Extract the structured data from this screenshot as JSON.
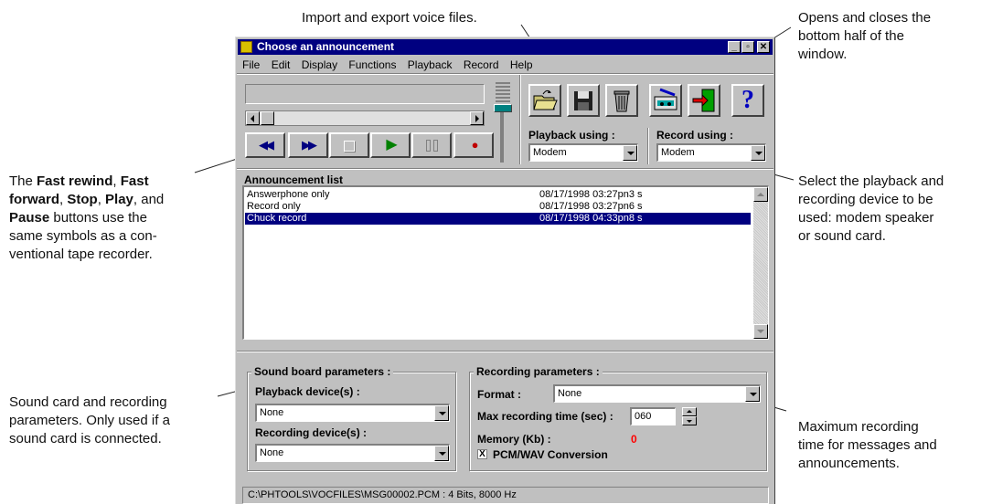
{
  "callouts": {
    "import_export": "Import and export voice files.",
    "opens_closes_1": "Opens and closes the",
    "opens_closes_2": "bottom half of the",
    "opens_closes_3": "window.",
    "tape_1_pre": "The ",
    "tape_1_b1": "Fast rewind",
    "tape_1_mid": ", ",
    "tape_1_b2": "Fast",
    "tape_2_b": "forward",
    "tape_2_mid1": ", ",
    "tape_2_b2": "Stop",
    "tape_2_mid2": ", ",
    "tape_2_b3": "Play",
    "tape_2_post": ", and",
    "tape_3_b": "Pause",
    "tape_3_post": " buttons use the",
    "tape_4": "same symbols as a con-",
    "tape_5": "ventional tape recorder.",
    "select_1": "Select the playback and",
    "select_2": "recording device to be",
    "select_3": "used: modem speaker",
    "select_4": "or sound card.",
    "sound_1": "Sound card and recording",
    "sound_2": "parameters. Only used if a",
    "sound_3": "sound card is connected.",
    "max_1": "Maximum recording",
    "max_2": "time for messages and",
    "max_3": "announcements."
  },
  "window": {
    "title": "Choose an announcement",
    "menu": [
      "File",
      "Edit",
      "Display",
      "Functions",
      "Playback",
      "Record",
      "Help"
    ]
  },
  "transport": {
    "buttons": [
      {
        "name": "fast-rewind-button",
        "glyph": "◀◀",
        "color": "#000080"
      },
      {
        "name": "fast-forward-button",
        "glyph": "▶▶",
        "color": "#000080"
      },
      {
        "name": "stop-button",
        "glyph": "",
        "color": "#808080"
      },
      {
        "name": "play-button",
        "glyph": "▶",
        "color": "#008000"
      },
      {
        "name": "pause-button",
        "glyph": "",
        "color": "#808080"
      },
      {
        "name": "record-button",
        "glyph": "●",
        "color": "#c00000"
      }
    ]
  },
  "toolbar": {
    "icons": [
      "open-folder-icon",
      "save-disk-icon",
      "trash-can-icon",
      "import-export-icon",
      "exit-door-icon",
      "help-question-icon"
    ],
    "help_glyph": "?"
  },
  "devices": {
    "playback_label": "Playback using :",
    "playback_value": "Modem",
    "record_label": "Record using :",
    "record_value": "Modem"
  },
  "announcements": {
    "header": "Announcement list",
    "rows": [
      {
        "name": "Answerphone only",
        "date": "08/17/1998 03:27pn3 s"
      },
      {
        "name": "Record only",
        "date": "08/17/1998 03:27pn6 s"
      },
      {
        "name": "Chuck record",
        "date": "08/17/1998 04:33pn8 s"
      }
    ]
  },
  "sound_board": {
    "title": "Sound board parameters :",
    "playback_label": "Playback device(s) :",
    "playback_value": "None",
    "recording_label": "Recording device(s) :",
    "recording_value": "None"
  },
  "recording": {
    "title": "Recording parameters :",
    "format_label": "Format :",
    "format_value": "None",
    "max_time_label": "Max recording time (sec) :",
    "max_time_value": "060",
    "memory_label": "Memory (Kb) :",
    "memory_value": "0",
    "memory_color": "#ff0000",
    "pcm_checked_glyph": "X",
    "pcm_label": "PCM/WAV Conversion"
  },
  "status": {
    "text": "C:\\PHTOOLS\\VOCFILES\\MSG00002.PCM : 4 Bits, 8000 Hz"
  }
}
